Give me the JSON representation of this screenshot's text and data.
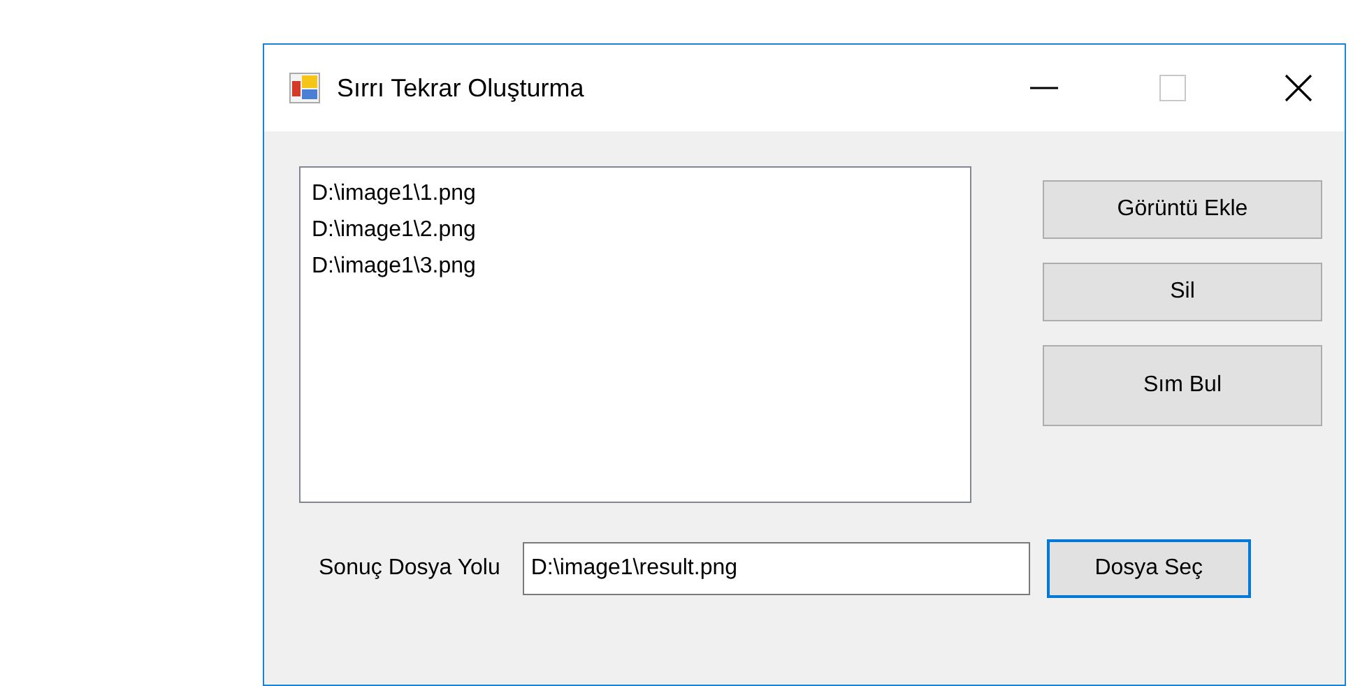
{
  "window": {
    "title": "Sırrı Tekrar Oluşturma"
  },
  "list": {
    "items": [
      "D:\\image1\\1.png",
      "D:\\image1\\2.png",
      "D:\\image1\\3.png"
    ]
  },
  "buttons": [
    {
      "label": "Görüntü Ekle",
      "kind": "normal"
    },
    {
      "label": "Sil",
      "kind": "normal"
    },
    {
      "label": "Sım Bul",
      "kind": "tall"
    }
  ],
  "output": {
    "label": "Sonuç Dosya Yolu",
    "value": "D:\\image1\\result.png",
    "button": {
      "label": "Dosya Seç",
      "focused": true
    }
  }
}
